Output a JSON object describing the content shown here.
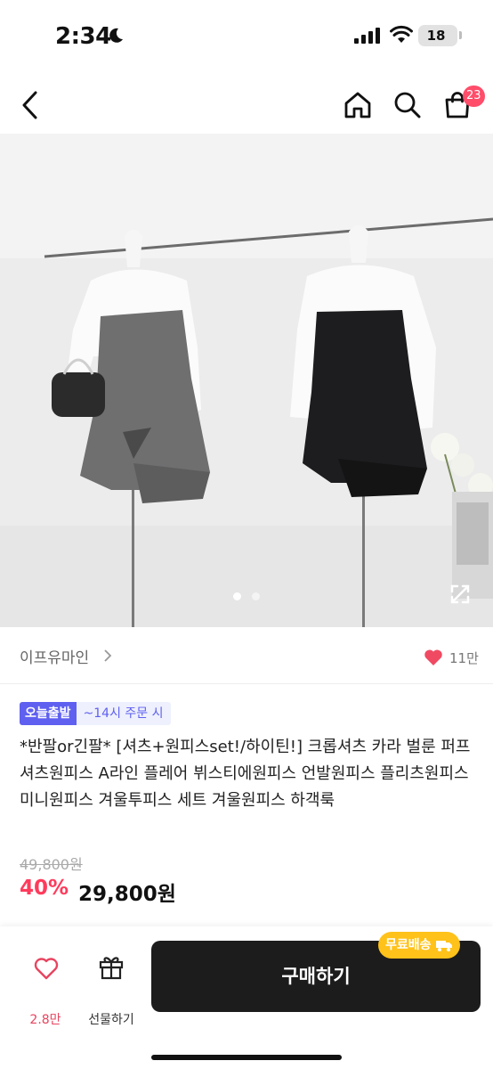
{
  "status_bar": {
    "time": "2:34",
    "battery": "18"
  },
  "nav": {
    "cart_count": "23"
  },
  "gallery": {
    "total_images": 2,
    "current_image": 1
  },
  "store": {
    "name": "이프유마인",
    "like_count": "11만"
  },
  "product": {
    "badge_today": "오늘출발",
    "badge_cutoff": "~14시 주문 시",
    "title": "*반팔or긴팔* [셔츠+원피스set!/하이틴!] 크롭셔츠 카라 벌룬 퍼프 셔츠원피스 A라인 플레어 뷔스티에원피스 언발원피스 플리츠원피스 미니원피스 겨울투피스 세트 겨울원피스 하객룩",
    "original_price": "49,800원",
    "discount": "40%",
    "price": "29,800원"
  },
  "bottom_bar": {
    "wish_count": "2.8만",
    "gift_label": "선물하기",
    "buy_label": "구매하기",
    "shipping_badge": "무료배송"
  },
  "colors": {
    "accent_pink": "#ff3b5c",
    "badge_purple": "#5f60f0",
    "shipping_yellow": "#ffc21a",
    "buy_button": "#1c1c1c"
  },
  "icons": {
    "back": "chevron-left-icon",
    "home": "home-icon",
    "search": "search-icon",
    "cart": "shopping-bag-icon",
    "like": "heart-icon",
    "gift": "gift-icon",
    "truck": "truck-icon",
    "expand": "expand-icon"
  }
}
